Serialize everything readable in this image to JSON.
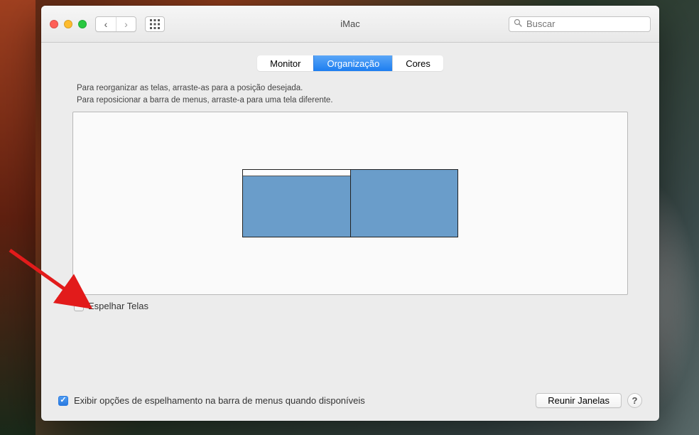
{
  "window": {
    "title": "iMac",
    "search_placeholder": "Buscar"
  },
  "tabs": {
    "monitor": "Monitor",
    "organization": "Organização",
    "colors": "Cores",
    "active_index": 1
  },
  "panel": {
    "instructions": "Para reorganizar as telas, arraste-as para a posição desejada.\nPara reposicionar a barra de menus, arraste-a para uma tela diferente.",
    "mirror_label": "Espelhar Telas",
    "mirror_checked": false
  },
  "footer": {
    "show_mirror_options_label": "Exibir opções de espelhamento na barra de menus quando disponíveis",
    "show_mirror_options_checked": true,
    "gather_windows_label": "Reunir Janelas",
    "help_label": "?"
  },
  "icons": {
    "search": "⌕",
    "grid": "grid",
    "back": "‹",
    "forward": "›"
  },
  "colors": {
    "accent": "#2a7ae0",
    "display_fill": "#6a9dca"
  }
}
